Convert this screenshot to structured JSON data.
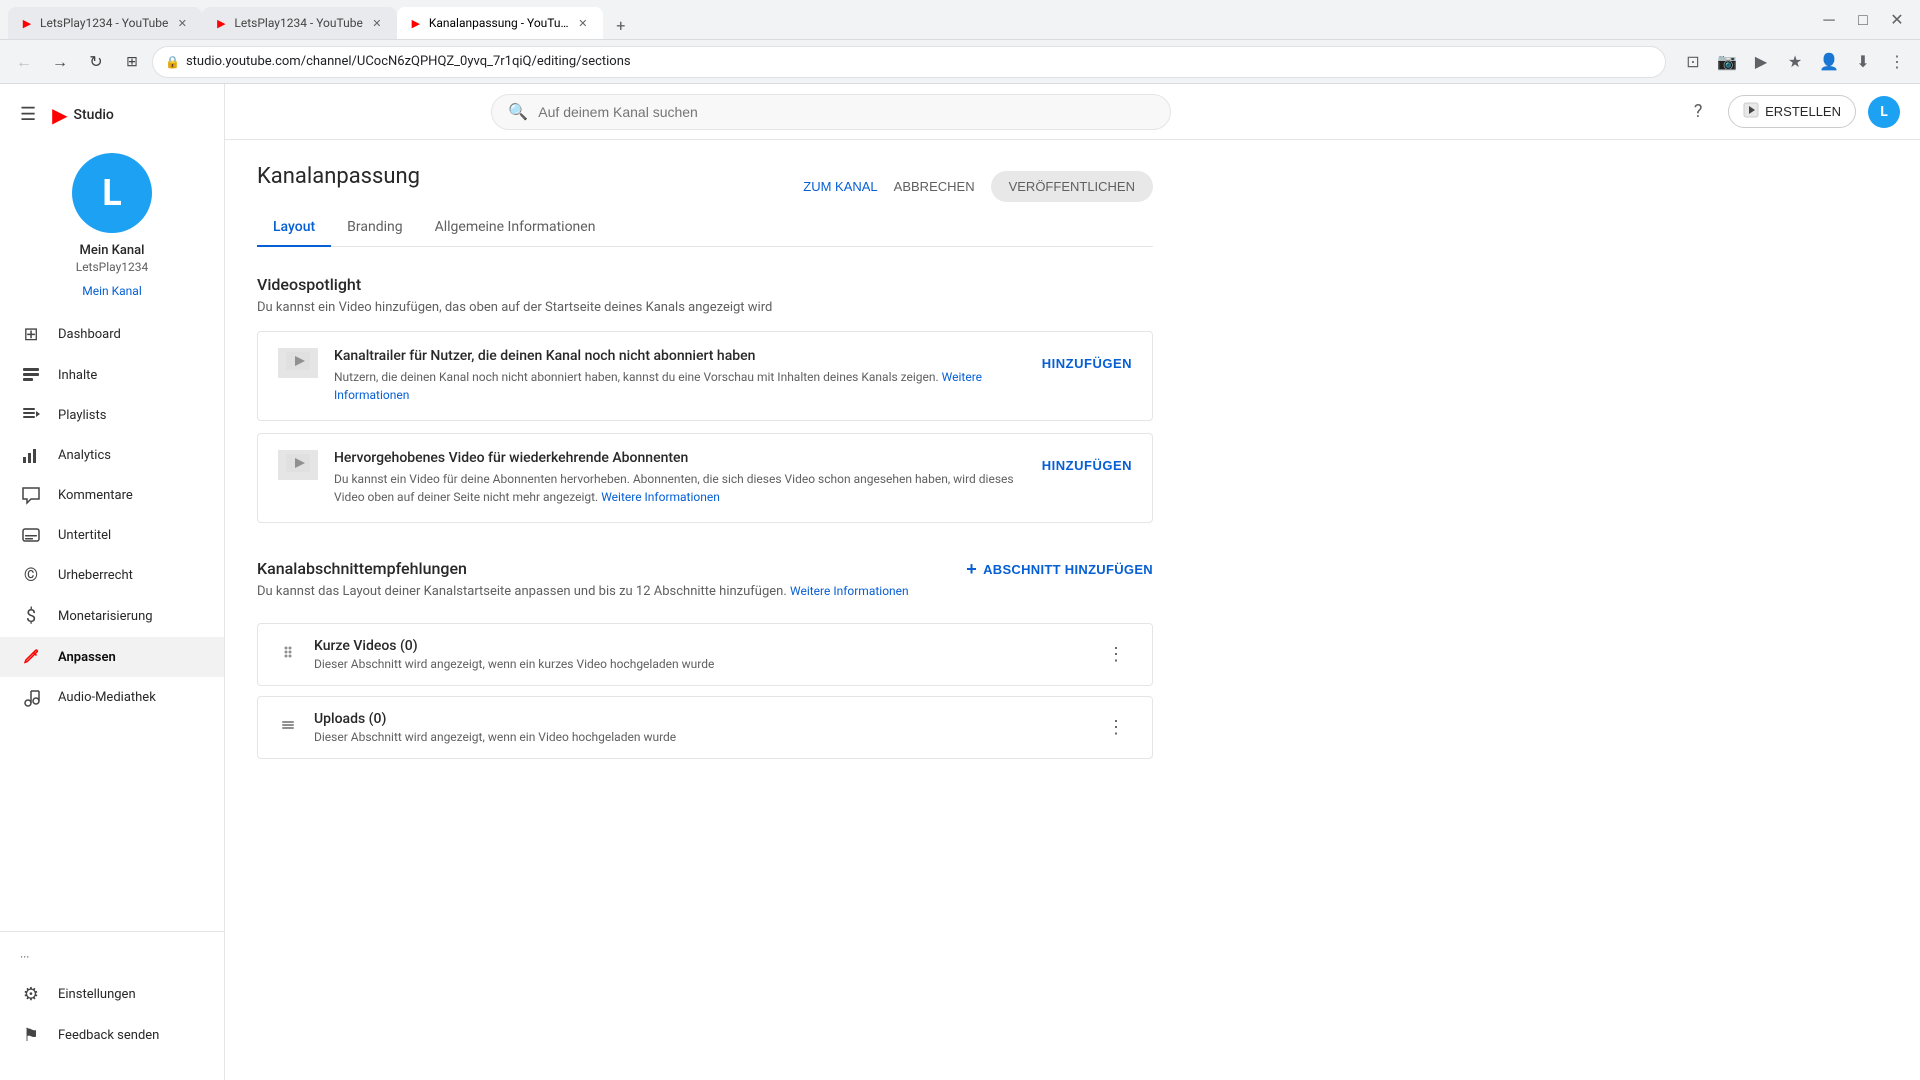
{
  "browser": {
    "tabs": [
      {
        "id": "tab1",
        "favicon": "▶",
        "title": "LetsPlay1234 - YouTube",
        "active": false,
        "color": "#ff0000"
      },
      {
        "id": "tab2",
        "favicon": "▶",
        "title": "LetsPlay1234 - YouTube",
        "active": false,
        "color": "#ff0000"
      },
      {
        "id": "tab3",
        "favicon": "▶",
        "title": "Kanalanpassung - YouTube",
        "active": true,
        "color": "#ff0000"
      }
    ],
    "url": "studio.youtube.com/channel/UCocN6zQPHQZ_0yvq_7r1qiQ/editing/sections",
    "new_tab_label": "+"
  },
  "sidebar": {
    "hamburger_label": "☰",
    "logo_text": "Studio",
    "channel": {
      "avatar_letter": "L",
      "name": "Mein Kanal",
      "handle": "LetsPlay1234"
    },
    "nav_items": [
      {
        "id": "dashboard",
        "icon": "⊞",
        "label": "Dashboard",
        "active": false
      },
      {
        "id": "inhalte",
        "icon": "≡",
        "label": "Inhalte",
        "active": false
      },
      {
        "id": "playlists",
        "icon": "☰",
        "label": "Playlists",
        "active": false
      },
      {
        "id": "analytics",
        "icon": "▦",
        "label": "Analytics",
        "active": false
      },
      {
        "id": "kommentare",
        "icon": "☰",
        "label": "Kommentare",
        "active": false
      },
      {
        "id": "untertitel",
        "icon": "▤",
        "label": "Untertitel",
        "active": false
      },
      {
        "id": "urheberrecht",
        "icon": "©",
        "label": "Urheberrecht",
        "active": false
      },
      {
        "id": "monetarisierung",
        "icon": "$",
        "label": "Monetarisierung",
        "active": false
      },
      {
        "id": "anpassen",
        "icon": "✏",
        "label": "Anpassen",
        "active": true
      },
      {
        "id": "audio-mediathek",
        "icon": "♪",
        "label": "Audio-Mediathek",
        "active": false
      }
    ],
    "footer_items": [
      {
        "id": "einstellungen",
        "icon": "⚙",
        "label": "Einstellungen"
      },
      {
        "id": "feedback",
        "icon": "⚑",
        "label": "Feedback senden"
      }
    ],
    "more_label": "···"
  },
  "topbar": {
    "search_placeholder": "Auf deinem Kanal suchen",
    "help_icon": "?",
    "create_label": "ERSTELLEN",
    "create_icon": "▶",
    "user_avatar_letter": "L"
  },
  "page": {
    "title": "Kanalanpassung",
    "tabs": [
      {
        "id": "layout",
        "label": "Layout",
        "active": true
      },
      {
        "id": "branding",
        "label": "Branding",
        "active": false
      },
      {
        "id": "allgemeine",
        "label": "Allgemeine Informationen",
        "active": false
      }
    ],
    "actions": {
      "zum_kanal": "ZUM KANAL",
      "abbrechen": "ABBRECHEN",
      "veroeffentlichen": "VERÖFFENTLICHEN"
    },
    "videospotlight": {
      "title": "Videospotlight",
      "desc": "Du kannst ein Video hinzufügen, das oben auf der Startseite deines Kanals angezeigt wird",
      "cards": [
        {
          "id": "trailer",
          "title": "Kanaltrailer für Nutzer, die deinen Kanal noch nicht abonniert haben",
          "desc": "Nutzern, die deinen Kanal noch nicht abonniert haben, kannst du eine Vorschau mit Inhalten deines Kanals zeigen.",
          "link_text": "Weitere Informationen",
          "btn_label": "HINZUFÜGEN"
        },
        {
          "id": "hervorgehoben",
          "title": "Hervorgehobenes Video für wiederkehrende Abonnenten",
          "desc": "Du kannst ein Video für deine Abonnenten hervorheben. Abonnenten, die sich dieses Video schon angesehen haben, wird dieses Video oben auf deiner Seite nicht mehr angezeigt.",
          "link_text": "Weitere Informationen",
          "btn_label": "HINZUFÜGEN"
        }
      ]
    },
    "kanalabschnitt": {
      "title": "Kanalabschnittempfehlungen",
      "desc": "Du kannst das Layout deiner Kanalstartseite anpassen und bis zu 12 Abschnitte hinzufügen.",
      "link_text": "Weitere Informationen",
      "add_btn_label": "+ ABSCHNITT HINZUFÜGEN",
      "items": [
        {
          "id": "kurze-videos",
          "title": "Kurze Videos (0)",
          "desc": "Dieser Abschnitt wird angezeigt, wenn ein kurzes Video hochgeladen wurde"
        },
        {
          "id": "uploads",
          "title": "Uploads (0)",
          "desc": "Dieser Abschnitt wird angezeigt, wenn ein Video hochgeladen wurde"
        }
      ]
    }
  }
}
